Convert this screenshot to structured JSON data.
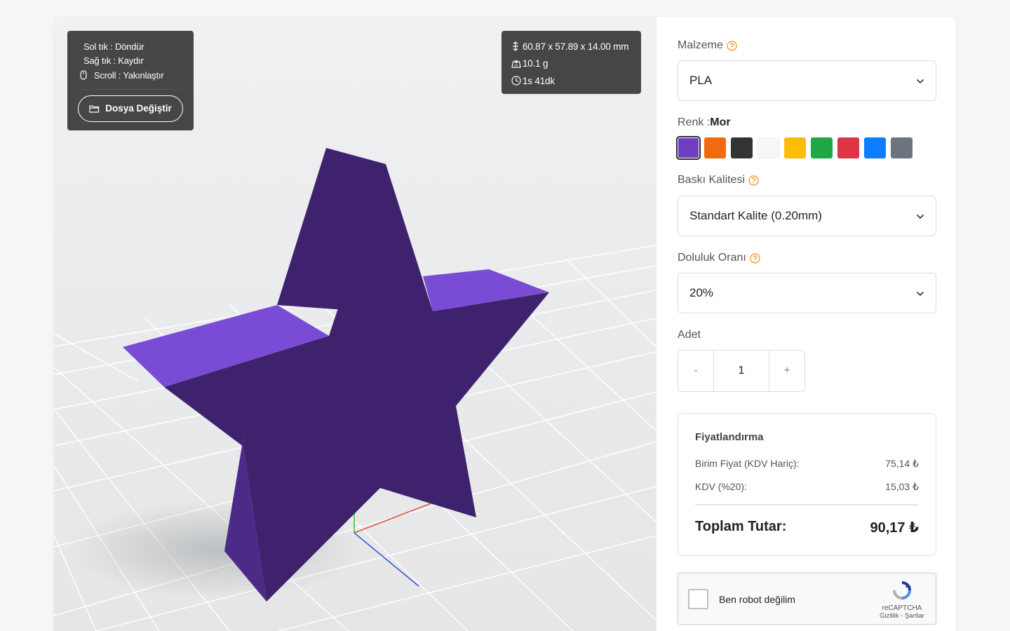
{
  "viewer": {
    "controls": {
      "left_click": "Sol tık : Döndür",
      "right_click": "Sağ tık : Kaydır",
      "scroll": "Scroll : Yakınlaştır",
      "change_file_label": "Dosya Değiştir"
    },
    "info": {
      "dimensions": "60.87 x 57.89 x 14.00 mm",
      "weight": "10.1 g",
      "print_time": "1s 41dk"
    },
    "model_colors": {
      "face": "#3f226e",
      "side": "#7a4cd6",
      "side_dark": "#4b2a88"
    }
  },
  "form": {
    "material": {
      "label": "Malzeme",
      "value": "PLA"
    },
    "color": {
      "label": "Renk :",
      "selected_name": "Mor",
      "swatches": [
        "#6f3fc0",
        "#f26a0f",
        "#333333",
        "#f6f8f8",
        "#fbbd08",
        "#21a744",
        "#dc3545",
        "#0d7dff",
        "#6c757d"
      ],
      "selected_index": 0
    },
    "quality": {
      "label": "Baskı Kalitesi",
      "value": "Standart Kalite (0.20mm)"
    },
    "infill": {
      "label": "Doluluk Oranı",
      "value": "20%"
    },
    "quantity": {
      "label": "Adet",
      "value": "1",
      "minus": "-",
      "plus": "+"
    },
    "pricing": {
      "title": "Fiyatlandırma",
      "unit_label": "Birim Fiyat (KDV Hariç):",
      "unit_value": "75,14 ₺",
      "vat_label": "KDV (%20):",
      "vat_value": "15,03 ₺",
      "total_label": "Toplam Tutar:",
      "total_value": "90,17 ₺"
    },
    "captcha": {
      "text": "Ben robot değilim",
      "brand": "reCAPTCHA",
      "links": "Gizlilik - Şartlar"
    }
  },
  "accent_colors": {
    "help_icon": "#f08c1a"
  }
}
